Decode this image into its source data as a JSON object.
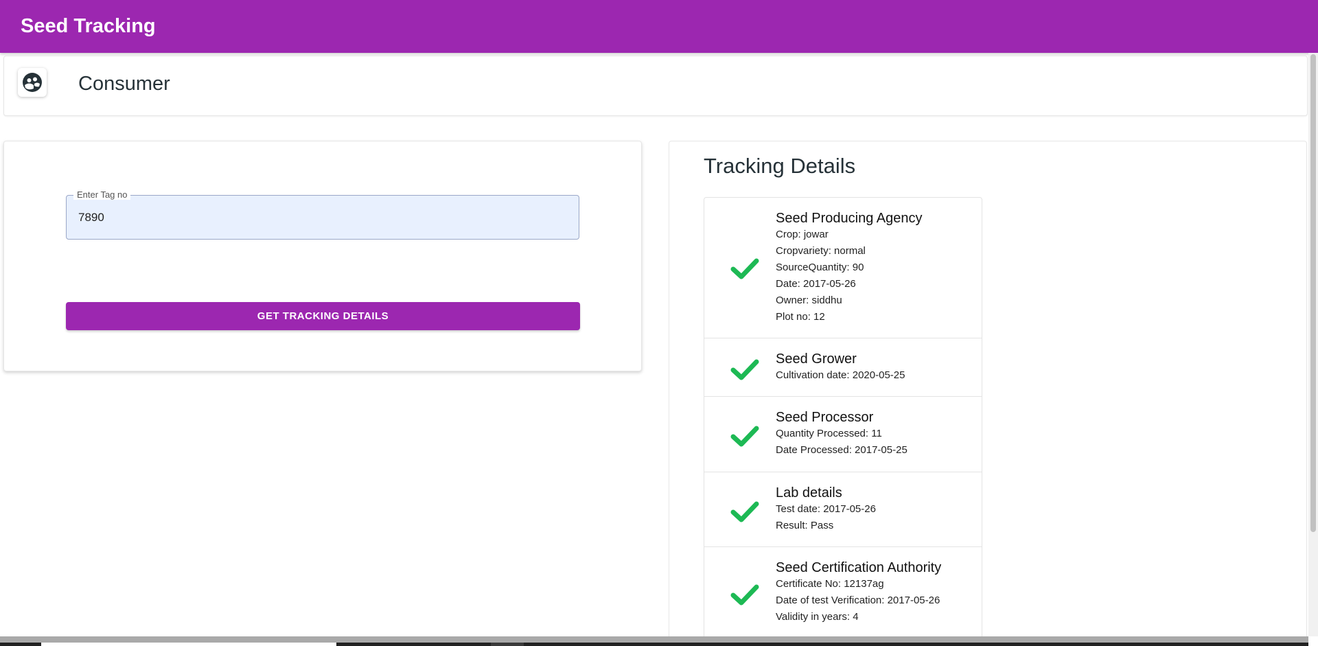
{
  "appbar": {
    "title": "Seed Tracking"
  },
  "consumer": {
    "title": "Consumer",
    "icon": "people-circle-icon"
  },
  "form": {
    "tag_label": "Enter Tag no",
    "tag_value": "7890",
    "button_label": "GET TRACKING DETAILS"
  },
  "details": {
    "title": "Tracking Details",
    "steps": [
      {
        "title": "Seed Producing Agency",
        "lines": [
          "Crop: jowar",
          "Cropvariety: normal",
          "SourceQuantity: 90",
          "Date: 2017-05-26",
          "Owner: siddhu",
          "Plot no: 12"
        ]
      },
      {
        "title": "Seed Grower",
        "lines": [
          "Cultivation date: 2020-05-25"
        ]
      },
      {
        "title": "Seed Processor",
        "lines": [
          "Quantity Processed: 11",
          "Date Processed: 2017-05-25"
        ]
      },
      {
        "title": "Lab details",
        "lines": [
          "Test date: 2017-05-26",
          "Result: Pass"
        ]
      },
      {
        "title": "Seed Certification Authority",
        "lines": [
          "Certificate No: 12137ag",
          "Date of test Verification: 2017-05-26",
          "Validity in years: 4"
        ]
      }
    ]
  },
  "colors": {
    "primary": "#9c27b0",
    "check": "#1db954",
    "field_bg": "#e8f0fe"
  }
}
